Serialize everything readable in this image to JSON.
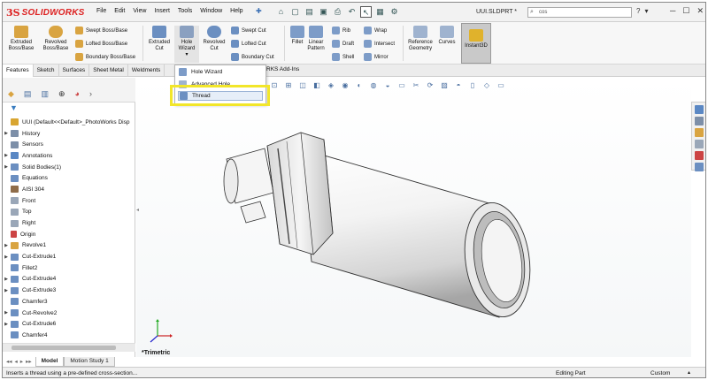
{
  "app": {
    "logo_ds": "3S",
    "logo_name": "SOLIDWORKS",
    "document": "UUI.SLDPRT *"
  },
  "menu": [
    "File",
    "Edit",
    "View",
    "Insert",
    "Tools",
    "Window",
    "Help"
  ],
  "search": {
    "value": "cos"
  },
  "ribbon": {
    "extruded_boss": "Extruded Boss/Base",
    "revolved_boss": "Revolved Boss/Base",
    "swept_boss": "Swept Boss/Base",
    "lofted_boss": "Lofted Boss/Base",
    "boundary_boss": "Boundary Boss/Base",
    "extruded_cut": "Extruded Cut",
    "hole_wizard": "Hole Wizard",
    "revolved_cut": "Revolved Cut",
    "swept_cut": "Swept Cut",
    "lofted_cut": "Lofted Cut",
    "boundary_cut": "Boundary Cut",
    "fillet": "Fillet",
    "linear_pattern": "Linear Pattern",
    "rib": "Rib",
    "draft": "Draft",
    "shell": "Shell",
    "wrap": "Wrap",
    "intersect": "Intersect",
    "mirror": "Mirror",
    "reference_geometry": "Reference Geometry",
    "curves": "Curves",
    "instant3d": "Instant3D"
  },
  "tabs": [
    "Features",
    "Sketch",
    "Surfaces",
    "Sheet Metal",
    "Weldments"
  ],
  "addins_fragment": "RKS Add-Ins",
  "dropdown": {
    "items": [
      "Hole Wizard",
      "Advanced Hole",
      "Thread"
    ]
  },
  "tree": [
    {
      "label": "UUI  (Default<<Default>_PhotoWorks Disp",
      "expand": "",
      "color": "#d8a531"
    },
    {
      "label": "History",
      "expand": "▶",
      "color": "#7d8fa8"
    },
    {
      "label": "Sensors",
      "expand": "",
      "color": "#7d8fa8"
    },
    {
      "label": "Annotations",
      "expand": "▶",
      "color": "#5b88c4"
    },
    {
      "label": "Solid Bodies(1)",
      "expand": "▶",
      "color": "#6b8fc1"
    },
    {
      "label": "Equations",
      "expand": "",
      "color": "#6b8fc1"
    },
    {
      "label": "AISI 304",
      "expand": "",
      "color": "#8f6d4a"
    },
    {
      "label": "Front",
      "expand": "",
      "color": "#9aa7b8"
    },
    {
      "label": "Top",
      "expand": "",
      "color": "#9aa7b8"
    },
    {
      "label": "Right",
      "expand": "",
      "color": "#9aa7b8"
    },
    {
      "label": "Origin",
      "expand": "",
      "color": "#c44"
    },
    {
      "label": "Revolve1",
      "expand": "▶",
      "color": "#d9a441"
    },
    {
      "label": "Cut-Extrude1",
      "expand": "▶",
      "color": "#6b8fc1"
    },
    {
      "label": "Fillet2",
      "expand": "",
      "color": "#6b8fc1"
    },
    {
      "label": "Cut-Extrude4",
      "expand": "▶",
      "color": "#6b8fc1"
    },
    {
      "label": "Cut-Extrude3",
      "expand": "▶",
      "color": "#6b8fc1"
    },
    {
      "label": "Chamfer3",
      "expand": "",
      "color": "#6b8fc1"
    },
    {
      "label": "Cut-Revolve2",
      "expand": "▶",
      "color": "#6b8fc1"
    },
    {
      "label": "Cut-Extrude6",
      "expand": "▶",
      "color": "#6b8fc1"
    },
    {
      "label": "Chamfer4",
      "expand": "",
      "color": "#6b8fc1"
    }
  ],
  "bottom_tabs": [
    "Model",
    "Motion Study 1"
  ],
  "viewport": {
    "view_label": "*Trimetric"
  },
  "status": {
    "hint": "Inserts a thread using a pre-defined cross-section...",
    "mode": "Editing Part",
    "units": "Custom"
  }
}
